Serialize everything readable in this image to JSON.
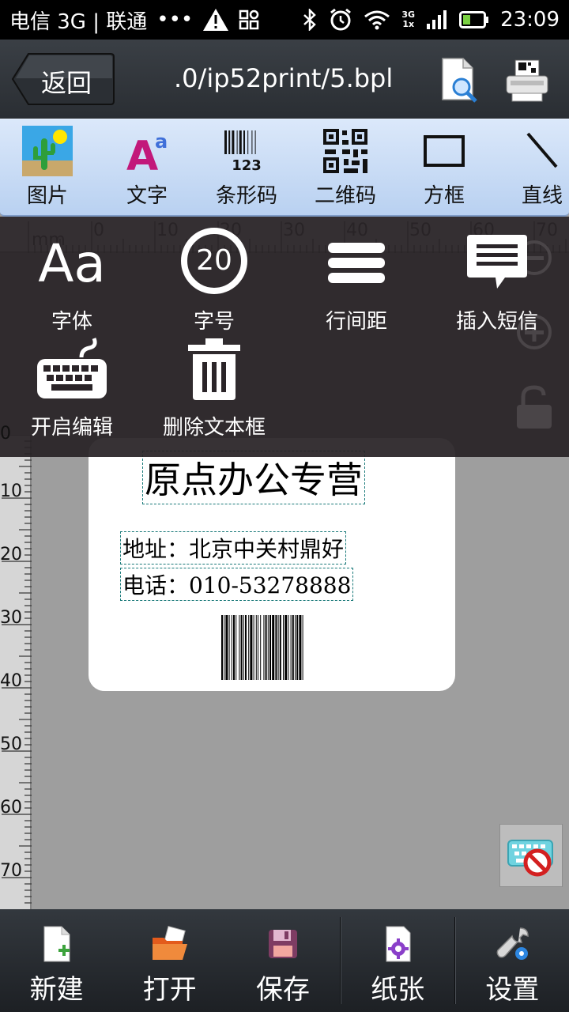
{
  "status_bar": {
    "carrier": "电信 3G | 联通",
    "dots": "•••",
    "network_small": "3G",
    "network_small2": "1x",
    "time": "23:09"
  },
  "title_bar": {
    "back_label": "返回",
    "file_title": ".0/ip52print/5.bpl"
  },
  "toolbar": {
    "items": [
      {
        "label": "图片",
        "icon": "picture-icon"
      },
      {
        "label": "文字",
        "icon": "text-icon"
      },
      {
        "label": "条形码",
        "icon": "barcode-icon",
        "caption": "123"
      },
      {
        "label": "二维码",
        "icon": "qrcode-icon"
      },
      {
        "label": "方框",
        "icon": "rectangle-icon"
      },
      {
        "label": "直线",
        "icon": "line-icon"
      }
    ]
  },
  "ruler": {
    "unit": "mm",
    "top_ticks": [
      "0",
      "10",
      "20",
      "30",
      "40",
      "50",
      "60",
      "70"
    ],
    "left_ticks": [
      "0",
      "10",
      "20",
      "30",
      "40",
      "50",
      "60",
      "70"
    ]
  },
  "text_menu": {
    "items": [
      {
        "label": "字体",
        "glyph": "Aa"
      },
      {
        "label": "字号",
        "glyph": "20"
      },
      {
        "label": "行间距"
      },
      {
        "label": "插入短信"
      },
      {
        "label": "开启编辑"
      },
      {
        "label": "删除文本框"
      }
    ]
  },
  "label": {
    "title": "原点办公专营",
    "address": "地址：北京中关村鼎好",
    "phone": "电话：010-53278888"
  },
  "bottom_bar": {
    "items": [
      {
        "label": "新建"
      },
      {
        "label": "打开"
      },
      {
        "label": "保存"
      },
      {
        "label": "纸张"
      },
      {
        "label": "设置"
      }
    ]
  },
  "colors": {
    "toolbar_bg": "#c6dbf6",
    "menu_bg": "#2a2428",
    "canvas_bg": "#9e9e9e",
    "text_accent": "#c2187a"
  }
}
